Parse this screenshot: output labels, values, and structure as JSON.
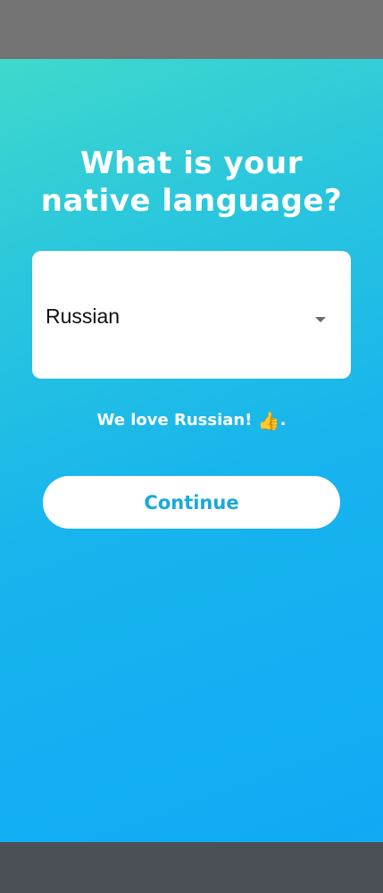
{
  "screen": {
    "title_line1": "What is your",
    "title_line2": "native language?",
    "language_select": {
      "selected_value": "Russian"
    },
    "love_message_text": "We love Russian! ",
    "love_message_emoji": "👍",
    "love_message_suffix": ".",
    "continue_label": "Continue"
  },
  "icons": {
    "dropdown": "chevron-down-icon",
    "thumbs": "thumbs-up-icon"
  },
  "colors": {
    "gradient_start": "#3fd9cc",
    "gradient_end": "#10aaf5",
    "button_text": "#1aa9d8",
    "status_bar": "#737373",
    "nav_bar": "#4b5056"
  }
}
